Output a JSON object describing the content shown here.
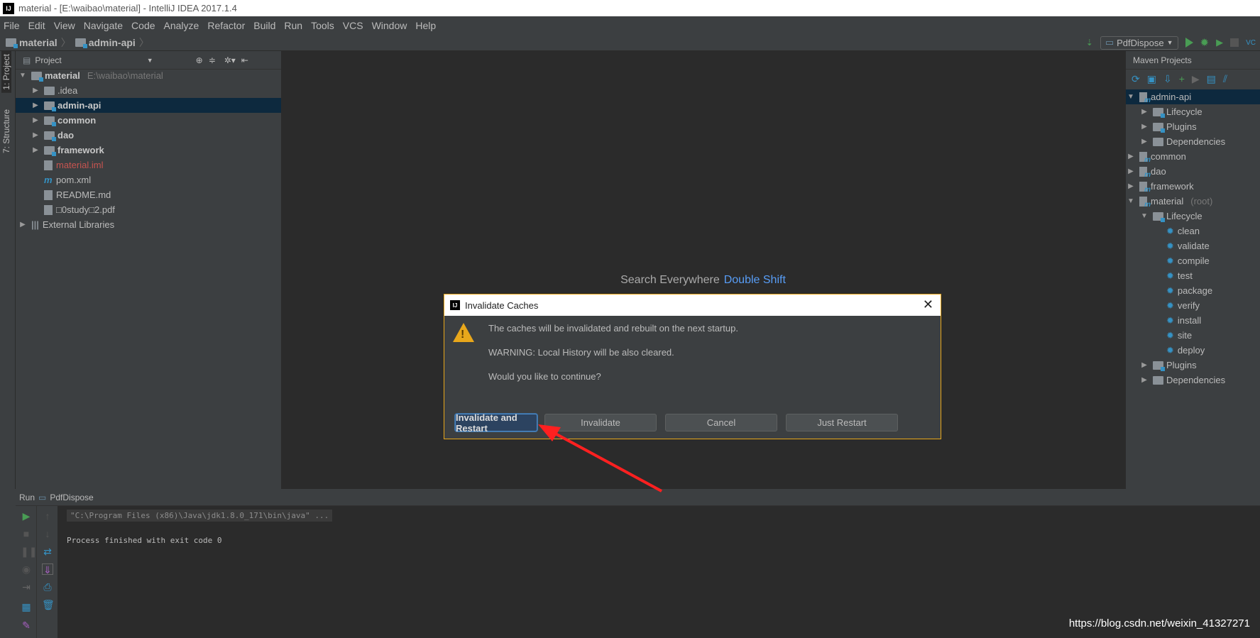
{
  "window": {
    "title": "material - [E:\\waibao\\material] - IntelliJ IDEA 2017.1.4",
    "logo": "IJ"
  },
  "menu": [
    "File",
    "Edit",
    "View",
    "Navigate",
    "Code",
    "Analyze",
    "Refactor",
    "Build",
    "Run",
    "Tools",
    "VCS",
    "Window",
    "Help"
  ],
  "breadcrumb": [
    "material",
    "admin-api"
  ],
  "run_config": "PdfDispose",
  "left_strip": {
    "project_tab": "1: Project",
    "structure_tab": "7: Structure"
  },
  "project": {
    "header": "Project",
    "tree": [
      {
        "label": "material",
        "extra": "E:\\waibao\\material",
        "depth": 0,
        "expander": "open",
        "icon": "module-folder",
        "bold": true
      },
      {
        "label": ".idea",
        "depth": 1,
        "expander": "closed",
        "icon": "folder"
      },
      {
        "label": "admin-api",
        "depth": 1,
        "expander": "closed",
        "icon": "module-folder",
        "bold": true,
        "selected": true
      },
      {
        "label": "common",
        "depth": 1,
        "expander": "closed",
        "icon": "module-folder",
        "bold": true
      },
      {
        "label": "dao",
        "depth": 1,
        "expander": "closed",
        "icon": "module-folder",
        "bold": true
      },
      {
        "label": "framework",
        "depth": 1,
        "expander": "closed",
        "icon": "module-folder",
        "bold": true
      },
      {
        "label": "material.iml",
        "depth": 1,
        "expander": "none",
        "icon": "iml-file",
        "color": "#c75450"
      },
      {
        "label": "pom.xml",
        "depth": 1,
        "expander": "none",
        "icon": "maven-file"
      },
      {
        "label": "README.md",
        "depth": 1,
        "expander": "none",
        "icon": "markdown-file"
      },
      {
        "label": "□0study□2.pdf",
        "depth": 1,
        "expander": "none",
        "icon": "unknown-file"
      },
      {
        "label": "External Libraries",
        "depth": 0,
        "expander": "closed",
        "icon": "libraries"
      }
    ]
  },
  "editor": {
    "search_label": "Search Everywhere",
    "search_shortcut": "Double Shift"
  },
  "maven": {
    "header": "Maven Projects",
    "tree": [
      {
        "label": "admin-api",
        "depth": 0,
        "expander": "open",
        "icon": "maven-module",
        "selected": true
      },
      {
        "label": "Lifecycle",
        "depth": 1,
        "expander": "closed",
        "icon": "lifecycle"
      },
      {
        "label": "Plugins",
        "depth": 1,
        "expander": "closed",
        "icon": "lifecycle"
      },
      {
        "label": "Dependencies",
        "depth": 1,
        "expander": "closed",
        "icon": "dependencies"
      },
      {
        "label": "common",
        "depth": 0,
        "expander": "closed",
        "icon": "maven-module"
      },
      {
        "label": "dao",
        "depth": 0,
        "expander": "closed",
        "icon": "maven-module"
      },
      {
        "label": "framework",
        "depth": 0,
        "expander": "closed",
        "icon": "maven-module"
      },
      {
        "label": "material",
        "extra": "(root)",
        "depth": 0,
        "expander": "open",
        "icon": "maven-module"
      },
      {
        "label": "Lifecycle",
        "depth": 1,
        "expander": "open",
        "icon": "lifecycle"
      },
      {
        "label": "clean",
        "depth": 2,
        "expander": "none",
        "icon": "gear"
      },
      {
        "label": "validate",
        "depth": 2,
        "expander": "none",
        "icon": "gear"
      },
      {
        "label": "compile",
        "depth": 2,
        "expander": "none",
        "icon": "gear"
      },
      {
        "label": "test",
        "depth": 2,
        "expander": "none",
        "icon": "gear"
      },
      {
        "label": "package",
        "depth": 2,
        "expander": "none",
        "icon": "gear"
      },
      {
        "label": "verify",
        "depth": 2,
        "expander": "none",
        "icon": "gear"
      },
      {
        "label": "install",
        "depth": 2,
        "expander": "none",
        "icon": "gear"
      },
      {
        "label": "site",
        "depth": 2,
        "expander": "none",
        "icon": "gear"
      },
      {
        "label": "deploy",
        "depth": 2,
        "expander": "none",
        "icon": "gear"
      },
      {
        "label": "Plugins",
        "depth": 1,
        "expander": "closed",
        "icon": "lifecycle"
      },
      {
        "label": "Dependencies",
        "depth": 1,
        "expander": "closed",
        "icon": "dependencies"
      }
    ]
  },
  "run_panel": {
    "tab_label": "Run",
    "config": "PdfDispose",
    "command": "\"C:\\Program Files (x86)\\Java\\jdk1.8.0_171\\bin\\java\" ...",
    "output": "Process finished with exit code 0"
  },
  "dialog": {
    "title": "Invalidate Caches",
    "close": "✕",
    "messages": [
      "The caches will be invalidated and rebuilt on the next startup.",
      "WARNING: Local History will be also cleared.",
      "Would you like to continue?"
    ],
    "buttons": [
      "Invalidate and Restart",
      "Invalidate",
      "Cancel",
      "Just Restart"
    ],
    "border_color": "#e8a71b"
  },
  "annotation": {
    "arrow_color": "#ff2020"
  },
  "watermark": "https://blog.csdn.net/weixin_41327271"
}
